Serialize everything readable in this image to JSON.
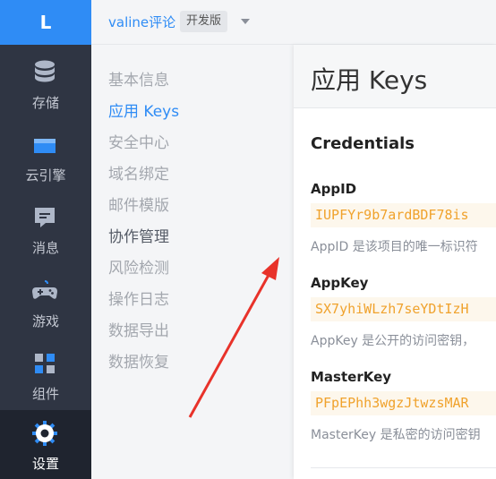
{
  "logo": "L",
  "sidebar": {
    "items": [
      {
        "label": "存储",
        "icon": "database-icon"
      },
      {
        "label": "云引擎",
        "icon": "cloud-engine-icon"
      },
      {
        "label": "消息",
        "icon": "message-icon"
      },
      {
        "label": "游戏",
        "icon": "gamepad-icon"
      },
      {
        "label": "组件",
        "icon": "components-icon"
      },
      {
        "label": "设置",
        "icon": "gear-icon",
        "active": true
      }
    ]
  },
  "topbar": {
    "app_name": "valine评论",
    "env_badge": "开发版",
    "dropdown_icon": "caret-down-icon"
  },
  "subnav": {
    "items": [
      {
        "label": "基本信息"
      },
      {
        "label": "应用 Keys",
        "active": true
      },
      {
        "label": "安全中心"
      },
      {
        "label": "域名绑定"
      },
      {
        "label": "邮件模版"
      },
      {
        "label": "协作管理"
      },
      {
        "label": "风险检测"
      },
      {
        "label": "操作日志"
      },
      {
        "label": "数据导出"
      },
      {
        "label": "数据恢复"
      }
    ]
  },
  "main": {
    "page_title": "应用 Keys",
    "section_title": "Credentials",
    "keys": [
      {
        "label": "AppID",
        "value": "IUPFYr9b7ardBDF78is",
        "desc": "AppID 是该项目的唯一标识符"
      },
      {
        "label": "AppKey",
        "value": "SX7yhiWLzh7seYDtIzH",
        "desc": "AppKey 是公开的访问密钥，"
      },
      {
        "label": "MasterKey",
        "value": "PFpEPhh3wgzJtwzsMAR",
        "desc": "MasterKey 是私密的访问密钥"
      }
    ]
  },
  "colors": {
    "brand_blue": "#2f8cf5",
    "sidebar_bg": "#2f3543",
    "key_text": "#f0a22c",
    "arrow_red": "#e8322a"
  }
}
